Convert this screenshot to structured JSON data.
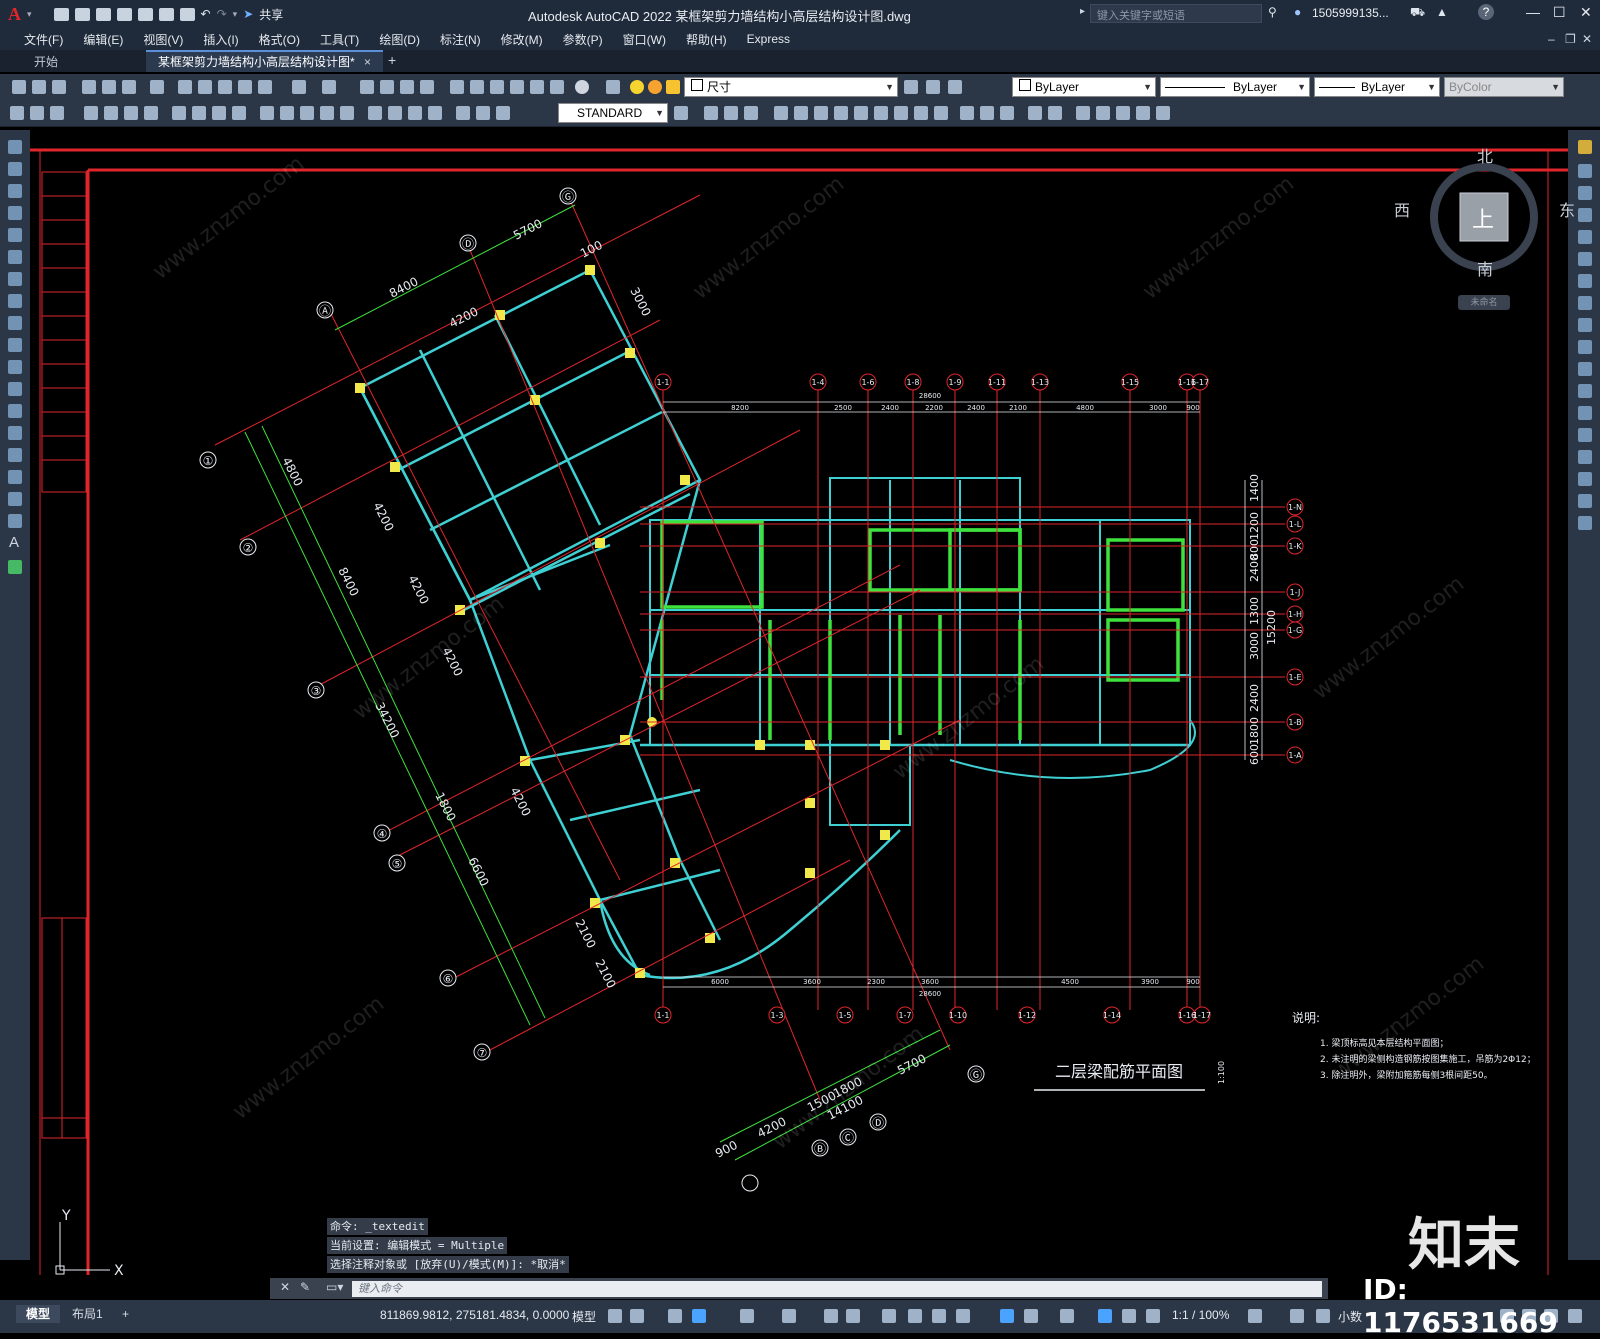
{
  "titlebar": {
    "logo": "A",
    "share_label": "共享",
    "app_title": "Autodesk AutoCAD 2022    某框架剪力墙结构小高层结构设计图.dwg",
    "search_placeholder": "键入关键字或短语",
    "user": "1505999135...",
    "help": "?"
  },
  "menu": [
    "文件(F)",
    "编辑(E)",
    "视图(V)",
    "插入(I)",
    "格式(O)",
    "工具(T)",
    "绘图(D)",
    "标注(N)",
    "修改(M)",
    "参数(P)",
    "窗口(W)",
    "帮助(H)",
    "Express"
  ],
  "tabs": {
    "start": "开始",
    "document": "某框架剪力墙结构小高层结构设计图*",
    "close": "×",
    "add": "+"
  },
  "toolbar": {
    "layer_combo": "尺寸",
    "color_combo": "ByLayer",
    "linetype_combo": "ByLayer",
    "lineweight_combo": "ByLayer",
    "plotstyle_combo": "ByColor",
    "textstyle_combo": "STANDARD"
  },
  "viewcube": {
    "north": "北",
    "south": "南",
    "east": "东",
    "west": "西",
    "face": "上",
    "ucs": "未命名"
  },
  "drawing": {
    "title": "二层梁配筋平面图",
    "scale_note": "1:100",
    "notes_title": "说明:",
    "notes": [
      "1. 梁顶标高见本层结构平面图；",
      "2. 未注明的梁侧构造钢筋按图集施工，吊筋为2Φ12；",
      "3. 除注明外，梁附加箍筋每侧3根间距50。"
    ],
    "axes_left": [
      "①",
      "②",
      "③",
      "④",
      "⑤",
      "⑥",
      "⑦"
    ],
    "axes_top": [
      "Ⓐ",
      "Ⓓ",
      "Ⓖ"
    ],
    "axes_grid_top": [
      "1-1",
      "1-4",
      "1-6",
      "1-8",
      "1-9",
      "1-11",
      "1-13",
      "1-15",
      "1-16",
      "1-17"
    ],
    "axes_grid_bottom": [
      "1-1",
      "1-3",
      "1-5",
      "1-7",
      "1-10",
      "1-12",
      "1-14",
      "1-16",
      "1-17"
    ],
    "axes_grid_right": [
      "1-N",
      "1-L",
      "1-K",
      "1-J",
      "1-H",
      "1-G",
      "1-E",
      "1-B",
      "1-A"
    ],
    "dims_top": [
      "8400",
      "5700",
      "4200",
      "100",
      "3000"
    ],
    "dims_left": [
      "4800",
      "8400",
      "34200",
      "1800",
      "6600",
      "4200",
      "4200",
      "4200",
      "4200",
      "2100",
      "2100"
    ],
    "dims_horizontal": [
      "28600",
      "8200",
      "2500",
      "2400",
      "2200",
      "2400",
      "2100",
      "4800",
      "3000",
      "900"
    ],
    "dims_horizontal_bottom": [
      "6000",
      "3600",
      "2300",
      "3600",
      "4500",
      "3900",
      "900",
      "28600"
    ],
    "dims_right": [
      "1400",
      "1200",
      "800",
      "2400",
      "1300",
      "3000",
      "15200",
      "2400",
      "1800",
      "600"
    ],
    "dims_bottom_left": [
      "900",
      "4200",
      "1500",
      "1800",
      "14100",
      "5700"
    ],
    "axes_bottom": [
      "Ⓑ",
      "Ⓒ",
      "Ⓓ",
      "Ⓖ"
    ],
    "ucs_x": "X",
    "ucs_y": "Y"
  },
  "command": {
    "history": [
      "命令: _textedit",
      "当前设置: 编辑模式 = Multiple",
      "选择注释对象或 [放弃(U)/模式(M)]: *取消*"
    ],
    "input_placeholder": "键入命令"
  },
  "status": {
    "model_tab": "模型",
    "layout_tab": "布局1",
    "add": "+",
    "coords": "811869.9812, 275181.4834, 0.0000",
    "mode": "模型",
    "scale": "1:1 / 100%",
    "units": "小数"
  },
  "watermark": {
    "logo": "知末",
    "id": "ID: 1176531669",
    "site": "www.znzmo.com"
  },
  "colors": {
    "red_line": "#e0262b",
    "cyan_beam": "#3fd0d4",
    "green_wall": "#3de23d",
    "yellow_col": "#f1e84a",
    "white_text": "#e8ecf2"
  }
}
